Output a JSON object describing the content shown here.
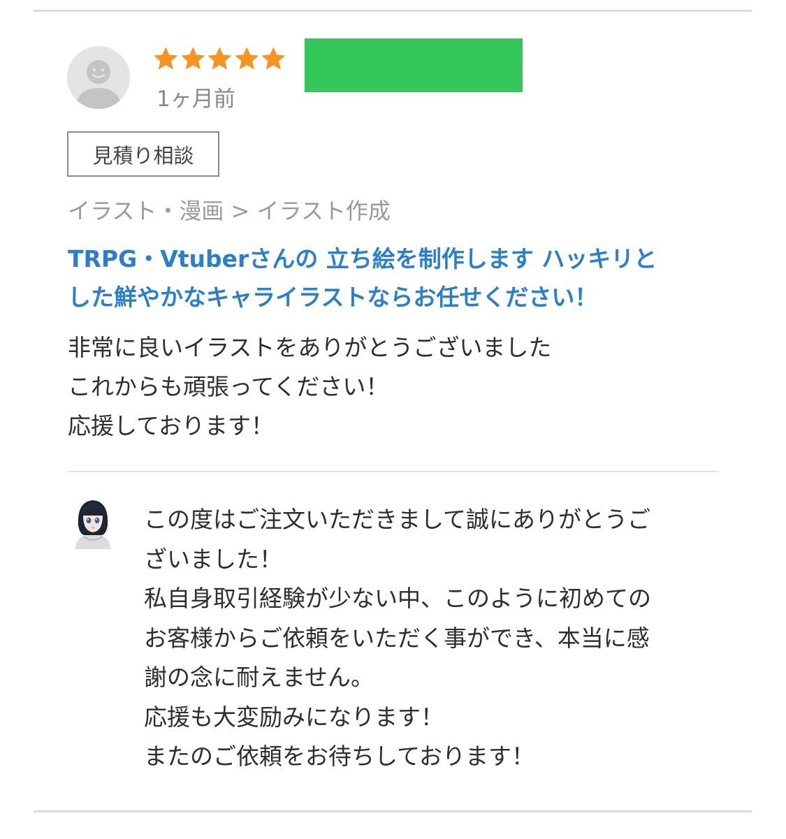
{
  "review": {
    "rating": 5,
    "rating_max": 5,
    "star_color": "#f7931e",
    "redaction_color": "#34c759",
    "time_ago": "1ヶ月前",
    "badge_label": "見積り相談",
    "category_path": "イラスト・漫画 > イラスト作成",
    "service_title_lines": [
      "TRPG・Vtuberさんの 立ち絵を制作します ハッキリと",
      "した鮮やかなキャライラストならお任せください！"
    ],
    "service_title_color": "#2a7fcb",
    "body_lines": [
      "非常に良いイラストをありがとうございました",
      "これからも頑張ってください！",
      "応援しております！"
    ]
  },
  "reply": {
    "body_lines": [
      "この度はご注文いただきまして誠にありがとうご",
      "ざいました！",
      "私自身取引経験が少ない中、このように初めての",
      "お客様からご依頼をいただく事ができ、本当に感",
      "謝の念に耐えません。",
      "応援も大変励みになります！",
      "またのご依頼をお待ちしております！"
    ]
  },
  "icons": {
    "reviewer_avatar": "default-user-avatar-icon",
    "seller_avatar": "anime-character-avatar-icon",
    "star": "star-icon"
  }
}
